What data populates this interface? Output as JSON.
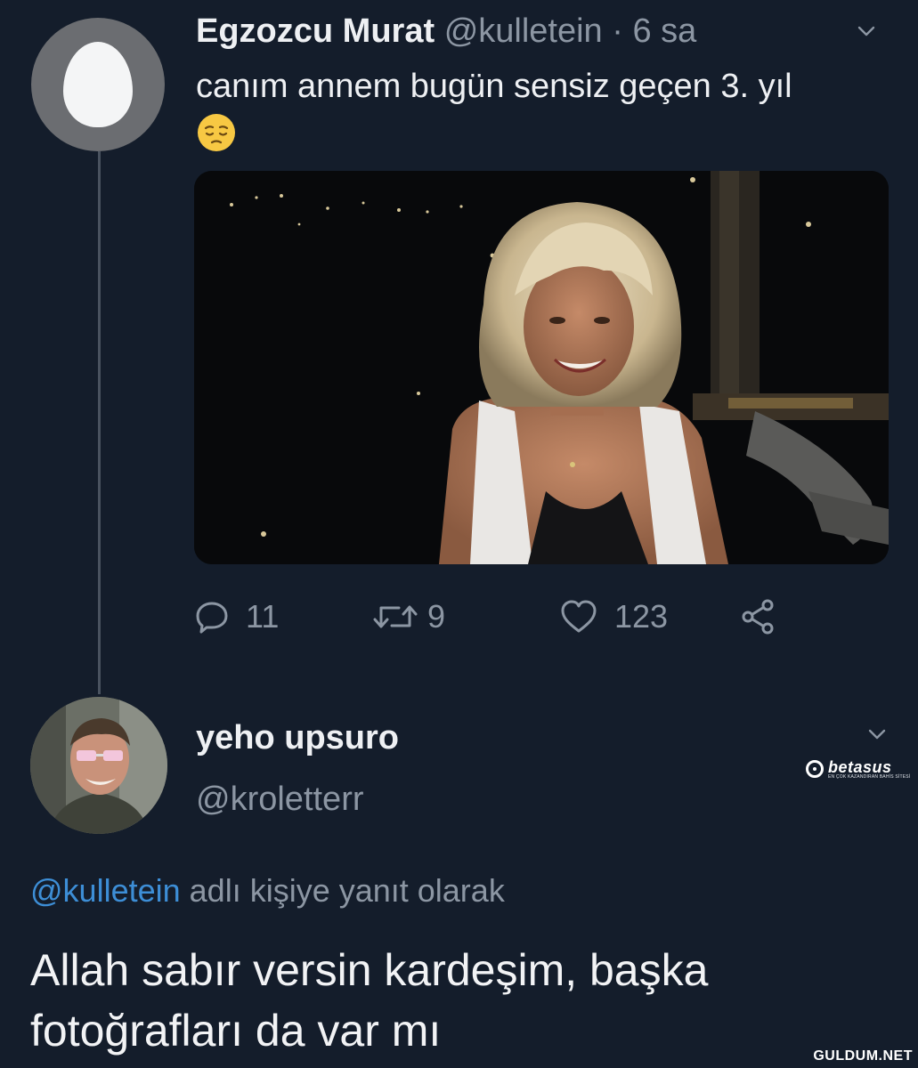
{
  "tweet": {
    "author_name": "Egzozcu Murat",
    "author_handle": "@kulletein",
    "separator": "·",
    "time": "6 sa",
    "text": "canım annem bugün sensiz geçen 3. yıl",
    "emoji": "pensive-face",
    "replies": "11",
    "retweets": "9",
    "likes": "123"
  },
  "reply": {
    "author_name": "yeho upsuro",
    "author_handle": "@kroletterr",
    "reply_to_mention": "@kulletein",
    "reply_to_suffix": "adlı kişiye yanıt olarak",
    "text": "Allah sabır versin kardeşim, başka fotoğrafları da var mı"
  },
  "watermarks": {
    "betasus": "betasus",
    "betasus_tagline": "EN ÇOK KAZANDIRAN BAHİS SİTESİ",
    "guldum": "GULDUM.NET"
  },
  "colors": {
    "background": "#141d2b",
    "secondary_text": "#8c96a3",
    "mention": "#3d8ed6"
  }
}
